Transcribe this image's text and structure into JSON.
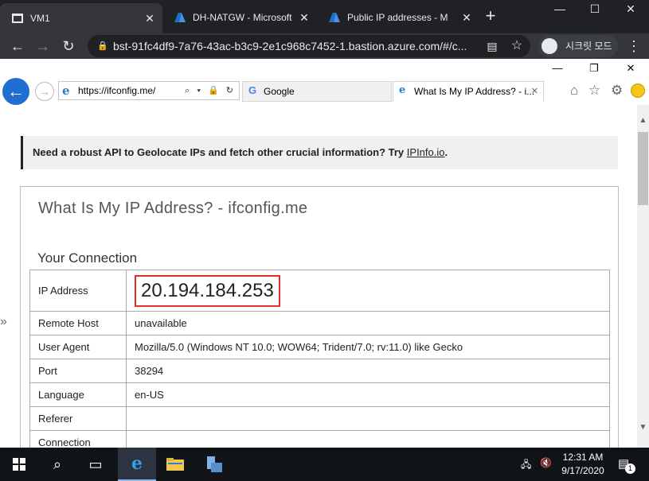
{
  "chrome": {
    "tabs": [
      {
        "title": "VM1",
        "icon": "window-icon",
        "active": true
      },
      {
        "title": "DH-NATGW - Microsoft",
        "icon": "azure-icon",
        "active": false
      },
      {
        "title": "Public IP addresses - M",
        "icon": "azure-icon",
        "active": false
      }
    ],
    "new_tab": "+",
    "close": "✕",
    "window_controls": {
      "minimize": "—",
      "maximize": "☐",
      "close": "✕"
    },
    "url": "bst-91fc4df9-7a76-43ac-b3c9-2e1c968c7452-1.bastion.azure.com/#/c...",
    "incognito_label": "시크릿 모드"
  },
  "ie": {
    "address": "https://ifconfig.me/",
    "address_tools": "⌕ ▾ 🔒 ↻",
    "tabs": [
      {
        "title": "Google",
        "selected": false
      },
      {
        "title": "What Is My IP Address? - i...",
        "selected": true
      }
    ],
    "controls": {
      "minimize": "—",
      "restore": "❐",
      "close": "✕"
    },
    "right_icons": "⌂ ☆ ⚙"
  },
  "page": {
    "banner_text": "Need a robust API to Geolocate IPs and fetch other crucial information? Try ",
    "banner_link": "IPInfo.io",
    "banner_end": ".",
    "card_title": "What Is My IP Address? - ifconfig.me",
    "section_title": "Your Connection",
    "rows": [
      {
        "key": "IP Address",
        "value": "20.194.184.253"
      },
      {
        "key": "Remote Host",
        "value": "unavailable"
      },
      {
        "key": "User Agent",
        "value": "Mozilla/5.0 (Windows NT 10.0; WOW64; Trident/7.0; rv:11.0) like Gecko"
      },
      {
        "key": "Port",
        "value": "38294"
      },
      {
        "key": "Language",
        "value": "en-US"
      },
      {
        "key": "Referer",
        "value": ""
      },
      {
        "key": "Connection",
        "value": ""
      }
    ]
  },
  "taskbar": {
    "time": "12:31 AM",
    "date": "9/17/2020",
    "notification_count": "1"
  }
}
